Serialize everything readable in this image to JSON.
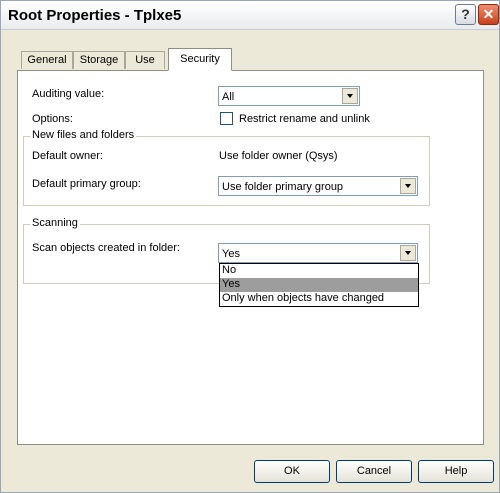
{
  "window": {
    "title": "Root Properties - Tplxe5",
    "help_glyph": "?",
    "close_glyph": "✕"
  },
  "tabs": [
    {
      "label": "General"
    },
    {
      "label": "Storage"
    },
    {
      "label": "Use"
    },
    {
      "label": "Security",
      "active": true
    }
  ],
  "security": {
    "auditing_label": "Auditing value:",
    "auditing_value": "All",
    "options_label": "Options:",
    "restrict_label": "Restrict rename and unlink",
    "restrict_checked": false,
    "new_files_group": "New files and folders",
    "default_owner_label": "Default owner:",
    "default_owner_value": "Use folder owner (Qsys)",
    "default_group_label": "Default primary group:",
    "default_group_value": "Use folder primary group",
    "scanning_group": "Scanning",
    "scan_label": "Scan objects created in folder:",
    "scan_value": "Yes",
    "scan_options": [
      "No",
      "Yes",
      "Only when objects have changed"
    ],
    "scan_highlighted": "Yes"
  },
  "buttons": {
    "ok": "OK",
    "cancel": "Cancel",
    "help": "Help"
  }
}
